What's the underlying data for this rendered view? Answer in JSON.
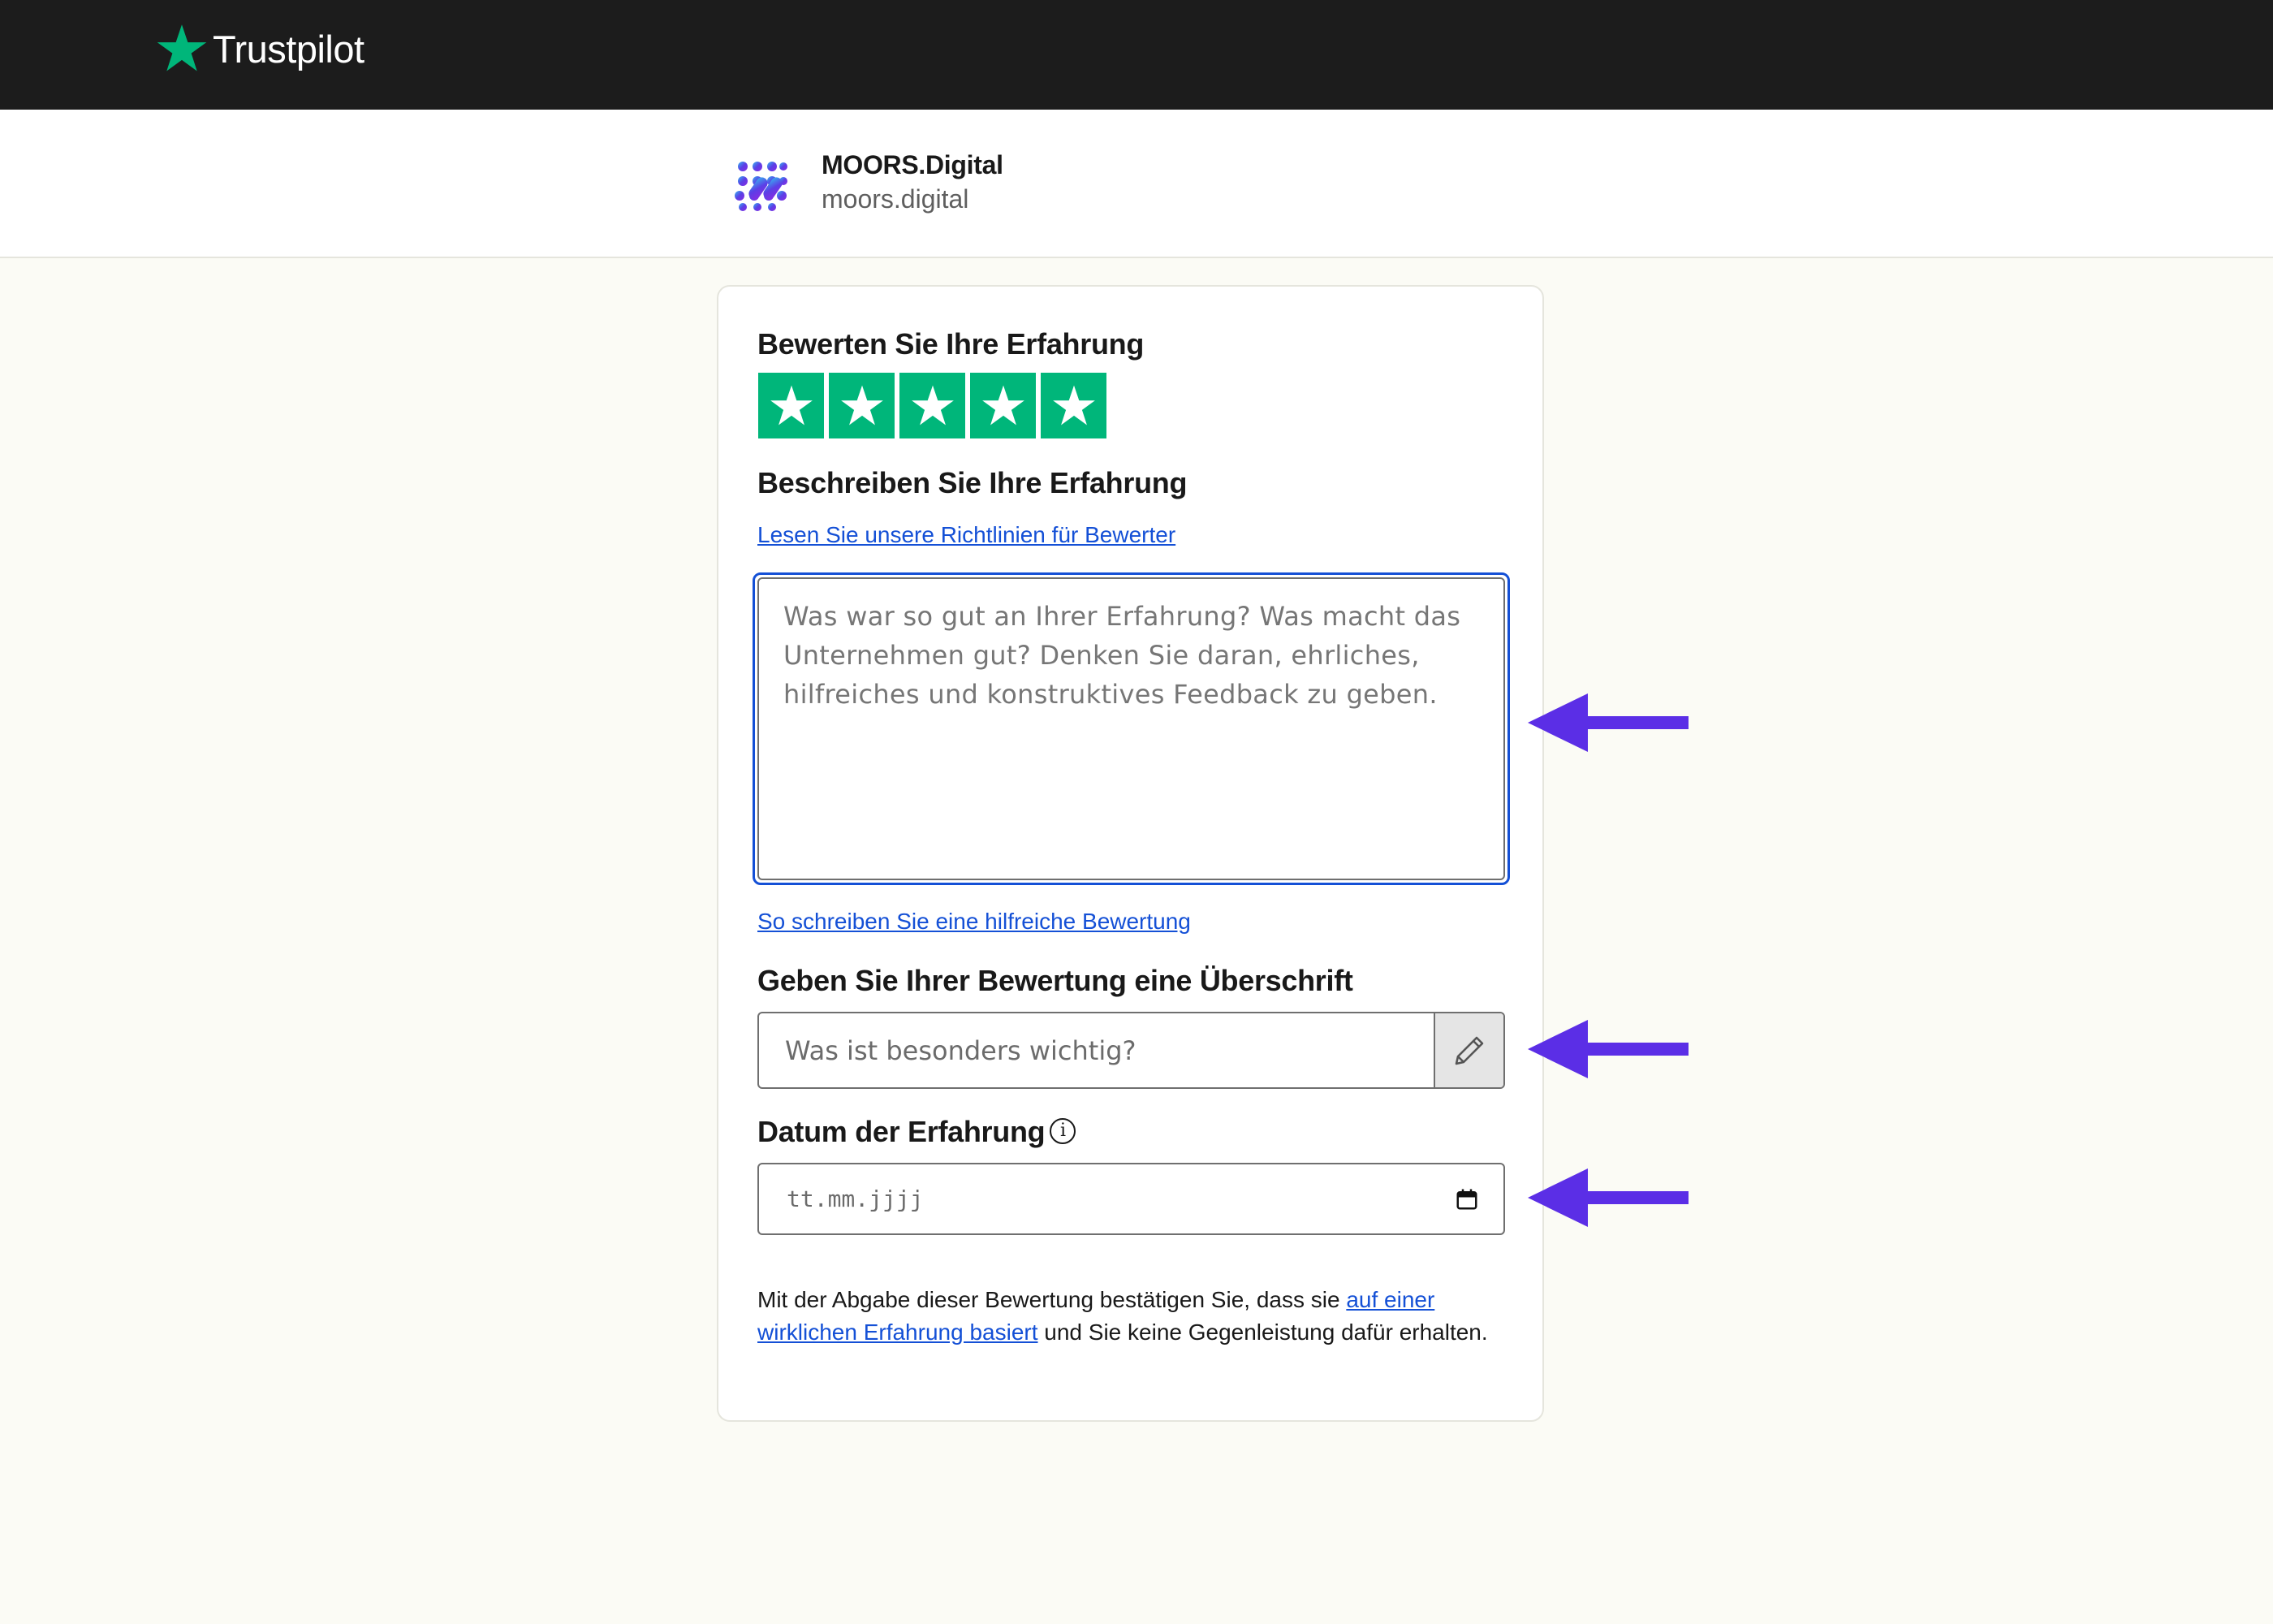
{
  "topbar": {
    "brand": "Trustpilot",
    "brand_color": "#00b67a"
  },
  "business": {
    "name": "MOORS.Digital",
    "domain": "moors.digital"
  },
  "review_form": {
    "rating_heading": "Bewerten Sie Ihre Erfahrung",
    "rating_value": 5,
    "rating_max": 5,
    "describe_heading": "Beschreiben Sie Ihre Erfahrung",
    "guidelines_link": "Lesen Sie unsere Richtlinien für Bewerter",
    "review_placeholder": "Was war so gut an Ihrer Erfahrung? Was macht das Unternehmen gut? Denken Sie daran, ehrliches, hilfreiches und konstruktives Feedback zu geben.",
    "helpful_link": "So schreiben Sie eine hilfreiche Bewertung",
    "title_heading": "Geben Sie Ihrer Bewertung eine Überschrift",
    "title_placeholder": "Was ist besonders wichtig?",
    "date_heading": "Datum der Erfahrung",
    "date_placeholder": "tt.mm.jjjj",
    "disclaimer_pre": "Mit der Abgabe dieser Bewertung bestätigen Sie, dass sie ",
    "disclaimer_link": "auf einer wirklichen Erfahrung basiert",
    "disclaimer_post": " und Sie keine Gegenleistung dafür erhalten."
  },
  "annotations": {
    "arrow_color": "#5b2ee6",
    "arrow_count": 3
  },
  "colors": {
    "star_green": "#00b67a",
    "link_blue": "#1450d6",
    "topbar_bg": "#1c1c1c",
    "page_bg": "#fbfbf5"
  }
}
